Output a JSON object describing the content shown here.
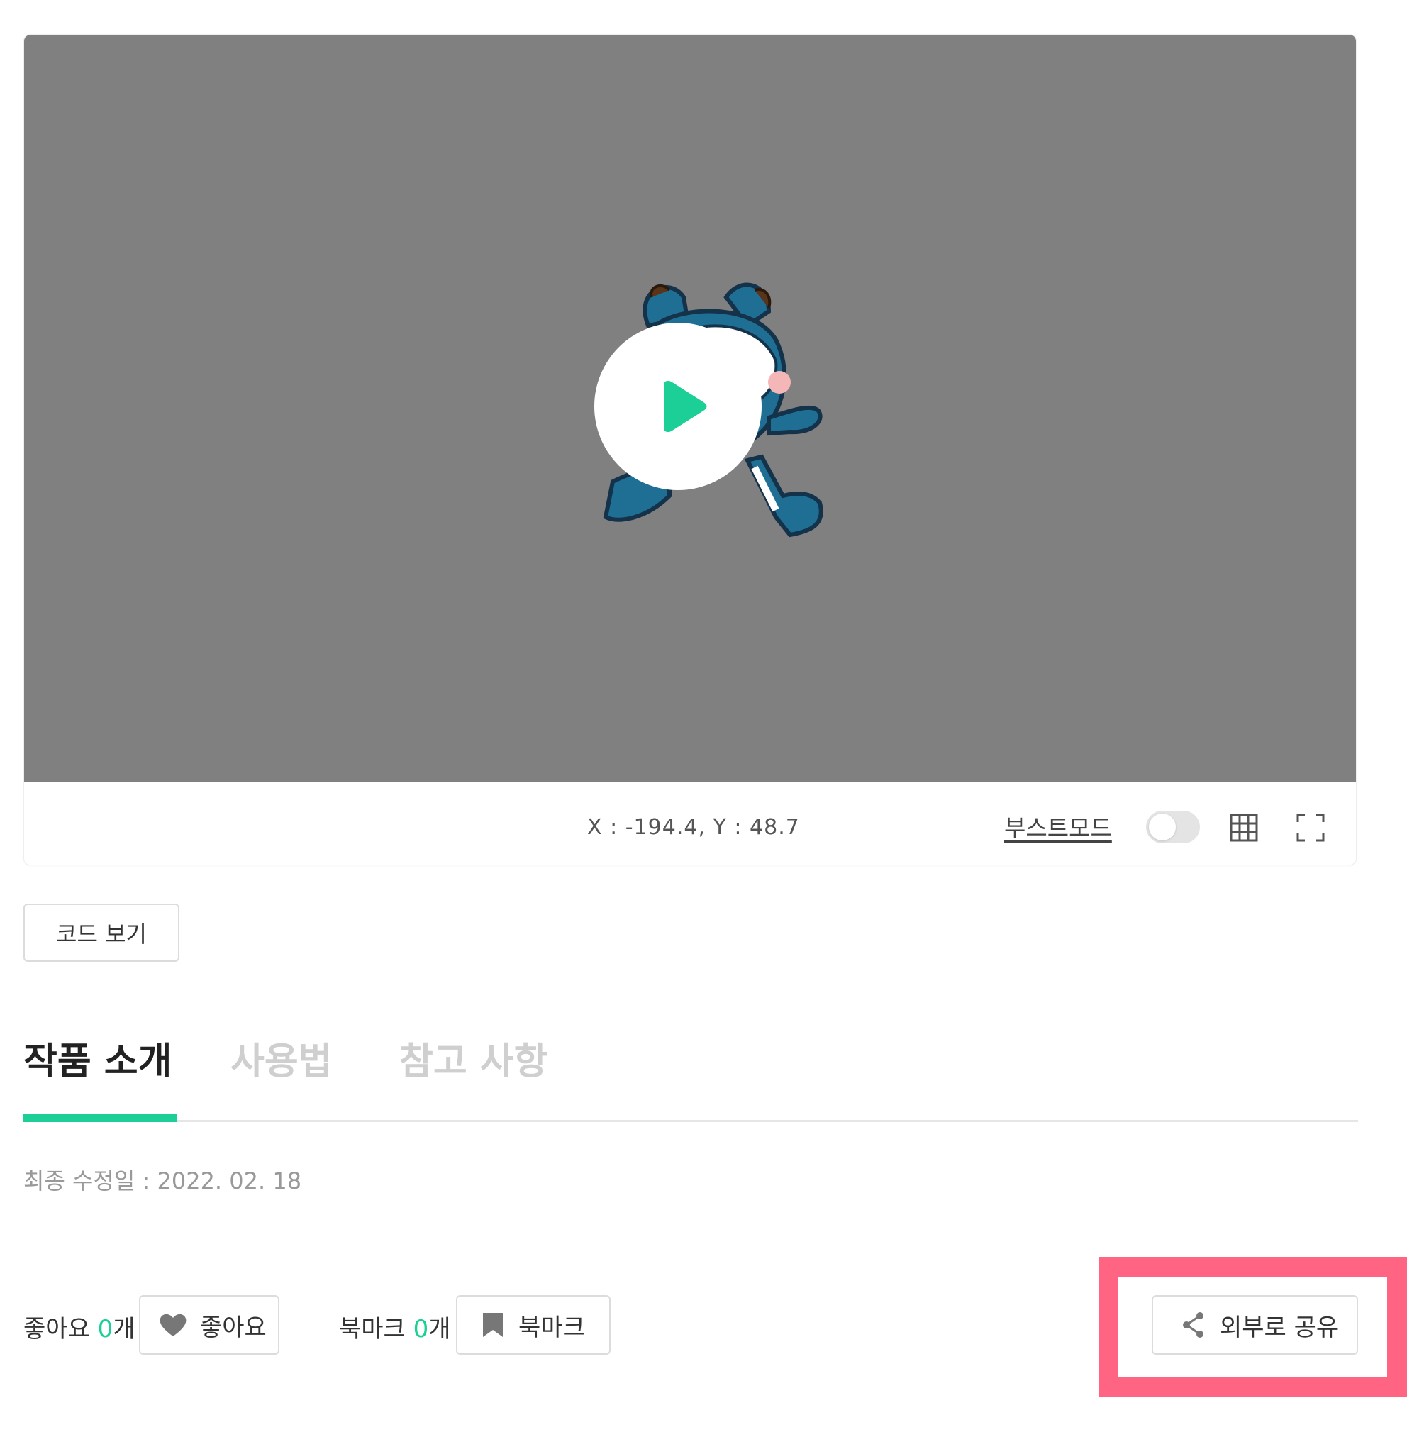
{
  "player": {
    "coords_text": "X : -194.4, Y : 48.7",
    "boost_mode_label": "부스트모드",
    "boost_mode_enabled": false,
    "stage_background": "#808080",
    "play_accent": "#1bcf96"
  },
  "code_view_button": "코드 보기",
  "tabs": [
    {
      "label": "작품 소개",
      "active": true
    },
    {
      "label": "사용법",
      "active": false
    },
    {
      "label": "참고 사항",
      "active": false
    }
  ],
  "last_modified": "최종 수정일 : 2022. 02. 18",
  "likes": {
    "label": "좋아요",
    "count": "0",
    "unit": "개",
    "button": "좋아요"
  },
  "bookmarks": {
    "label": "북마크",
    "count": "0",
    "unit": "개",
    "button": "북마크"
  },
  "share_button": "외부로 공유",
  "highlight_color": "#ff6483",
  "icons": [
    "play-icon",
    "grid-icon",
    "fullscreen-icon",
    "heart-icon",
    "bookmark-icon",
    "share-icon"
  ]
}
